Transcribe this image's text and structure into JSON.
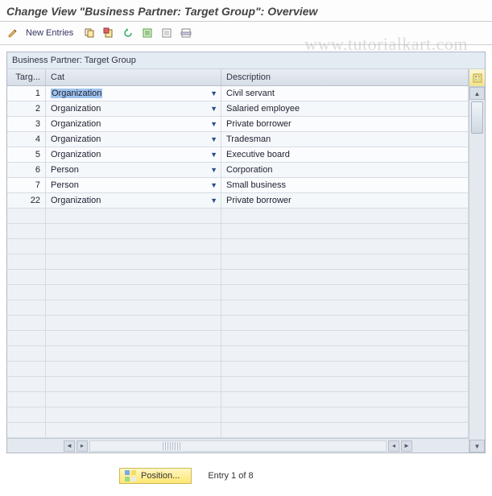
{
  "title": "Change View \"Business Partner: Target Group\": Overview",
  "toolbar": {
    "new_entries_label": "New Entries"
  },
  "watermark": "www.tutorialkart.com",
  "panel": {
    "title": "Business Partner: Target Group",
    "columns": {
      "targ": "Targ...",
      "cat": "Cat",
      "desc": "Description"
    },
    "rows": [
      {
        "targ": "1",
        "cat": "Organization",
        "selected": true,
        "desc": "Civil servant"
      },
      {
        "targ": "2",
        "cat": "Organization",
        "selected": false,
        "desc": "Salaried employee"
      },
      {
        "targ": "3",
        "cat": "Organization",
        "selected": false,
        "desc": "Private borrower"
      },
      {
        "targ": "4",
        "cat": "Organization",
        "selected": false,
        "desc": "Tradesman"
      },
      {
        "targ": "5",
        "cat": "Organization",
        "selected": false,
        "desc": "Executive board"
      },
      {
        "targ": "6",
        "cat": "Person",
        "selected": false,
        "desc": "Corporation"
      },
      {
        "targ": "7",
        "cat": "Person",
        "selected": false,
        "desc": "Small business"
      },
      {
        "targ": "22",
        "cat": "Organization",
        "selected": false,
        "desc": "Private borrower"
      }
    ],
    "empty_rows": 15
  },
  "footer": {
    "position_label": "Position...",
    "entry_text": "Entry 1 of 8"
  }
}
